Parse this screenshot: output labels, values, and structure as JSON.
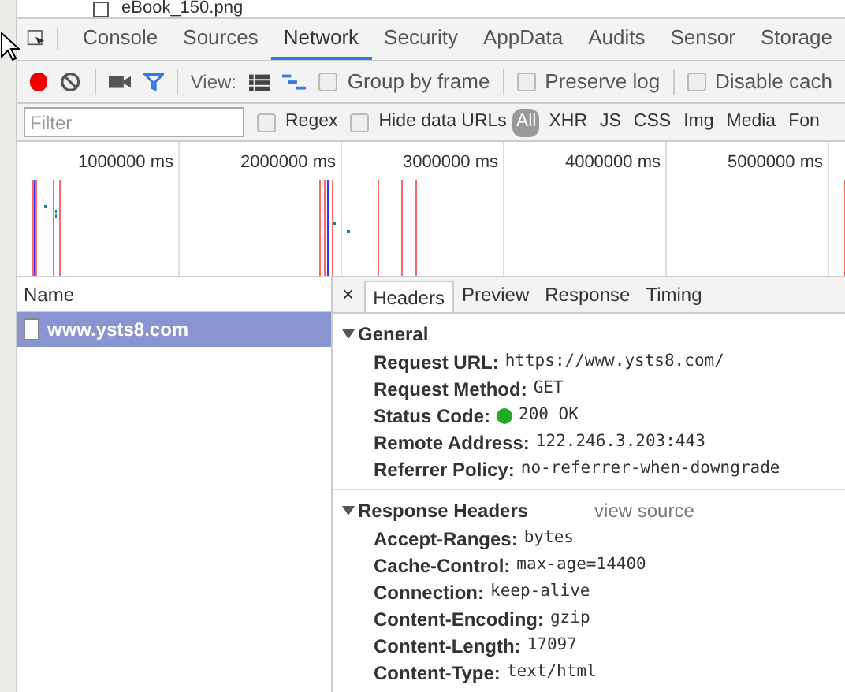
{
  "behind": {
    "file": "eBook_150.png"
  },
  "tabs": [
    {
      "label": "Console",
      "selected": false
    },
    {
      "label": "Sources",
      "selected": false
    },
    {
      "label": "Network",
      "selected": true
    },
    {
      "label": "Security",
      "selected": false
    },
    {
      "label": "AppData",
      "selected": false
    },
    {
      "label": "Audits",
      "selected": false
    },
    {
      "label": "Sensor",
      "selected": false
    },
    {
      "label": "Storage",
      "selected": false
    }
  ],
  "toolbar": {
    "recording": true,
    "view_label": "View:",
    "large_rows": false,
    "overview": true,
    "options": [
      {
        "label": "Group by frame",
        "checked": false
      },
      {
        "label": "Preserve log",
        "checked": false
      },
      {
        "label": "Disable cach",
        "checked": false
      }
    ]
  },
  "filter": {
    "placeholder": "Filter",
    "regex": {
      "label": "Regex",
      "checked": false
    },
    "hide_data": {
      "label": "Hide data URLs",
      "checked": false
    },
    "types": [
      {
        "label": "All",
        "selected": true
      },
      {
        "label": "XHR",
        "selected": false
      },
      {
        "label": "JS",
        "selected": false
      },
      {
        "label": "CSS",
        "selected": false
      },
      {
        "label": "Img",
        "selected": false
      },
      {
        "label": "Media",
        "selected": false
      },
      {
        "label": "Fon",
        "selected": false
      }
    ]
  },
  "timeline": {
    "ticks": [
      "1000000 ms",
      "2000000 ms",
      "3000000 ms",
      "4000000 ms",
      "5000000 ms"
    ]
  },
  "requests": {
    "header": "Name",
    "rows": [
      {
        "name": "www.ysts8.com",
        "selected": true
      }
    ]
  },
  "details": {
    "close": "×",
    "tabs": [
      {
        "label": "Headers",
        "selected": true
      },
      {
        "label": "Preview",
        "selected": false
      },
      {
        "label": "Response",
        "selected": false
      },
      {
        "label": "Timing",
        "selected": false
      }
    ],
    "sections": [
      {
        "title": "General",
        "expanded": true,
        "rows": [
          {
            "key": "Request URL:",
            "value": "https://www.ysts8.com/"
          },
          {
            "key": "Request Method:",
            "value": "GET"
          },
          {
            "key": "Status Code:",
            "value": "200 OK",
            "color": "#22aa22"
          },
          {
            "key": "Remote Address:",
            "value": "122.246.3.203:443"
          },
          {
            "key": "Referrer Policy:",
            "value": "no-referrer-when-downgrade"
          }
        ]
      },
      {
        "title": "Response Headers",
        "expanded": true,
        "link": "view source",
        "rows": [
          {
            "key": "Accept-Ranges:",
            "value": "bytes"
          },
          {
            "key": "Cache-Control:",
            "value": "max-age=14400"
          },
          {
            "key": "Connection:",
            "value": "keep-alive"
          },
          {
            "key": "Content-Encoding:",
            "value": "gzip"
          },
          {
            "key": "Content-Length:",
            "value": "17097"
          },
          {
            "key": "Content-Type:",
            "value": "text/html"
          }
        ]
      }
    ]
  }
}
